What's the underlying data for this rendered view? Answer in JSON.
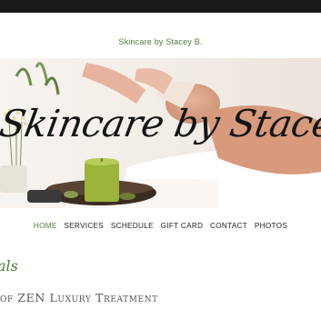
{
  "site": {
    "title": "Skincare by Stacey B.",
    "hero_script": "Skincare by Stacey B."
  },
  "nav": {
    "items": [
      "HOME",
      "SERVICES",
      "SCHEDULE",
      "GIFT CARD",
      "CONTACT",
      "PHOTOS"
    ],
    "active_index": 0
  },
  "section": {
    "script_fragment": "als",
    "heading_fragment": "of ZEN Luxury Treatment"
  },
  "colors": {
    "accent_green": "#4f7a3c",
    "topbar": "#1b1b1b",
    "text": "#222222"
  }
}
